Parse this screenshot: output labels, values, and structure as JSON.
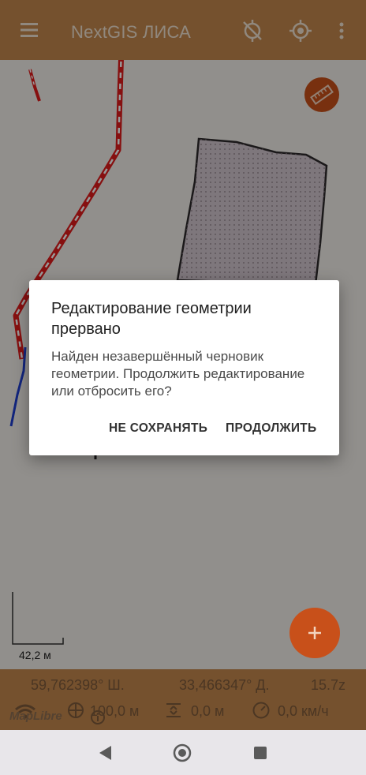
{
  "app": {
    "title": "NextGIS ЛИСА"
  },
  "map": {
    "scale_label": "42,2 м",
    "attribution": "MapLibre"
  },
  "status": {
    "latitude": "59,762398° Ш.",
    "longitude": "33,466347° Д.",
    "zoom": "15.7z",
    "accuracy": "100,0 м",
    "altitude": "0,0 м",
    "speed": "0,0 км/ч"
  },
  "dialog": {
    "title": "Редактирование геометрии прервано",
    "message": "Найден незавершённый черновик геометрии. Продолжить редактирование или отбросить его?",
    "negative_button": "НЕ СОХРАНЯТЬ",
    "positive_button": "ПРОДОЛЖИТЬ"
  },
  "icons": {
    "menu": "menu-icon",
    "no_location": "location-off-icon",
    "my_location": "gps-fixed-icon",
    "more": "more-vert-icon",
    "ruler": "ruler-icon",
    "add": "add-icon",
    "wifi": "wifi-icon",
    "target": "target-icon",
    "altitude": "altitude-icon",
    "speedometer": "speedometer-icon",
    "info": "info-icon",
    "back": "back-triangle-icon",
    "home": "home-circle-icon",
    "recents": "recents-square-icon"
  },
  "colors": {
    "toolbar": "#c4874d",
    "fab": "#c8501a",
    "track_red": "#e01c1c",
    "track_blue": "#1f3fd0"
  }
}
